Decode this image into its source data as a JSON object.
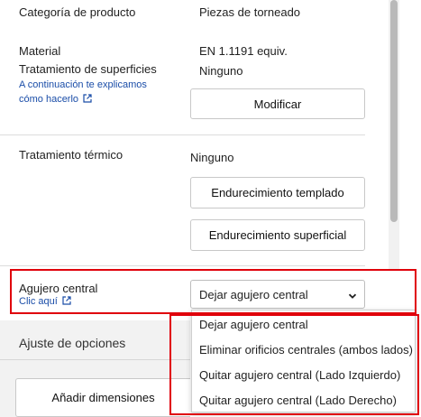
{
  "rows": {
    "category": {
      "label": "Categoría de producto",
      "value": "Piezas de torneado"
    },
    "material": {
      "label": "Material",
      "value": "EN 1.1191 equiv."
    },
    "surface": {
      "label": "Tratamiento de superficies",
      "value": "Ninguno",
      "help_line1": "A continuación te explicamos",
      "help_line2": "cómo hacerlo",
      "button": "Modificar"
    },
    "heat": {
      "label": "Tratamiento térmico",
      "value": "Ninguno",
      "button1": "Endurecimiento templado",
      "button2": "Endurecimiento superficial"
    },
    "center_hole": {
      "label": "Agujero central",
      "help": "Clic aquí",
      "selected": "Dejar agujero central",
      "options": [
        "Dejar agujero central",
        "Eliminar orificios centrales (ambos lados)",
        "Quitar agujero central (Lado Izquierdo)",
        "Quitar agujero central (Lado Derecho)"
      ]
    }
  },
  "options_panel": {
    "title": "Ajuste de opciones",
    "add_dimensions": "Añadir dimensiones"
  },
  "colors": {
    "link": "#1a4da8",
    "highlight": "#e0000b"
  }
}
